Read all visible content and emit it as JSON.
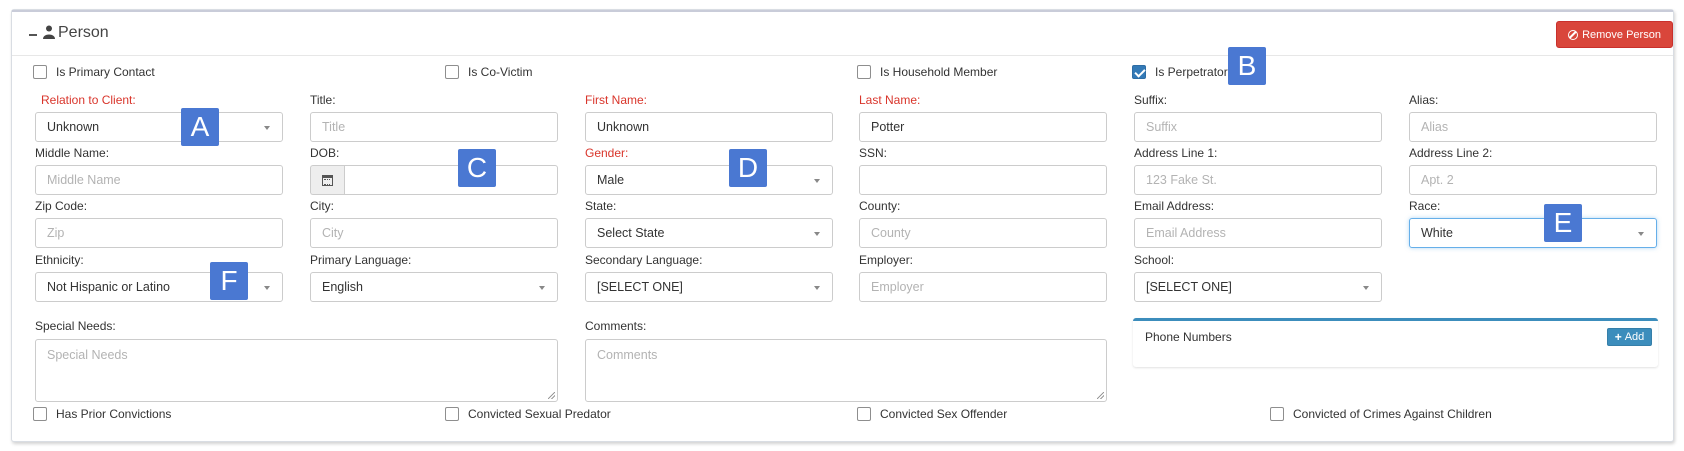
{
  "panel": {
    "title": "Person",
    "remove_button": "Remove Person"
  },
  "top_checkboxes": [
    {
      "label": "Is Primary Contact",
      "checked": false
    },
    {
      "label": "Is Co-Victim",
      "checked": false
    },
    {
      "label": "Is Household Member",
      "checked": false
    },
    {
      "label": "Is Perpetrator",
      "checked": true
    }
  ],
  "fields": {
    "relation": {
      "label": "Relation to Client:",
      "value": "Unknown",
      "required": true
    },
    "title": {
      "label": "Title:",
      "placeholder": "Title"
    },
    "first_name": {
      "label": "First Name:",
      "value": "Unknown",
      "required": true
    },
    "last_name": {
      "label": "Last Name:",
      "value": "Potter",
      "required": true
    },
    "suffix": {
      "label": "Suffix:",
      "placeholder": "Suffix"
    },
    "alias": {
      "label": "Alias:",
      "placeholder": "Alias"
    },
    "middle_name": {
      "label": "Middle Name:",
      "placeholder": "Middle Name"
    },
    "dob": {
      "label": "DOB:",
      "value": ""
    },
    "gender": {
      "label": "Gender:",
      "value": "Male",
      "required": true
    },
    "ssn": {
      "label": "SSN:",
      "value": ""
    },
    "address1": {
      "label": "Address Line 1:",
      "placeholder": "123 Fake St."
    },
    "address2": {
      "label": "Address Line 2:",
      "placeholder": "Apt. 2"
    },
    "zip": {
      "label": "Zip Code:",
      "placeholder": "Zip"
    },
    "city": {
      "label": "City:",
      "placeholder": "City"
    },
    "state": {
      "label": "State:",
      "value": "Select State"
    },
    "county": {
      "label": "County:",
      "placeholder": "County"
    },
    "email": {
      "label": "Email Address:",
      "placeholder": "Email Address"
    },
    "race": {
      "label": "Race:",
      "value": "White"
    },
    "ethnicity": {
      "label": "Ethnicity:",
      "value": "Not Hispanic or Latino"
    },
    "primary_language": {
      "label": "Primary Language:",
      "value": "English"
    },
    "secondary_language": {
      "label": "Secondary Language:",
      "value": "[SELECT ONE]"
    },
    "employer": {
      "label": "Employer:",
      "placeholder": "Employer"
    },
    "school": {
      "label": "School:",
      "value": "[SELECT ONE]"
    },
    "special_needs": {
      "label": "Special Needs:",
      "placeholder": "Special Needs"
    },
    "comments": {
      "label": "Comments:",
      "placeholder": "Comments"
    }
  },
  "phone_numbers": {
    "title": "Phone Numbers",
    "add_label": "Add"
  },
  "bottom_checkboxes": [
    {
      "label": "Has Prior Convictions",
      "checked": false
    },
    {
      "label": "Convicted Sexual Predator",
      "checked": false
    },
    {
      "label": "Convicted Sex Offender",
      "checked": false
    },
    {
      "label": "Convicted of Crimes Against Children",
      "checked": false
    }
  ],
  "markers": [
    "A",
    "B",
    "C",
    "D",
    "E",
    "F"
  ],
  "colors": {
    "required_label": "#d9352b",
    "remove_button": "#d9463b",
    "checkbox_checked": "#337ab7",
    "phone_panel_accent": "#3c8dbc",
    "marker": "#4a78d2"
  }
}
